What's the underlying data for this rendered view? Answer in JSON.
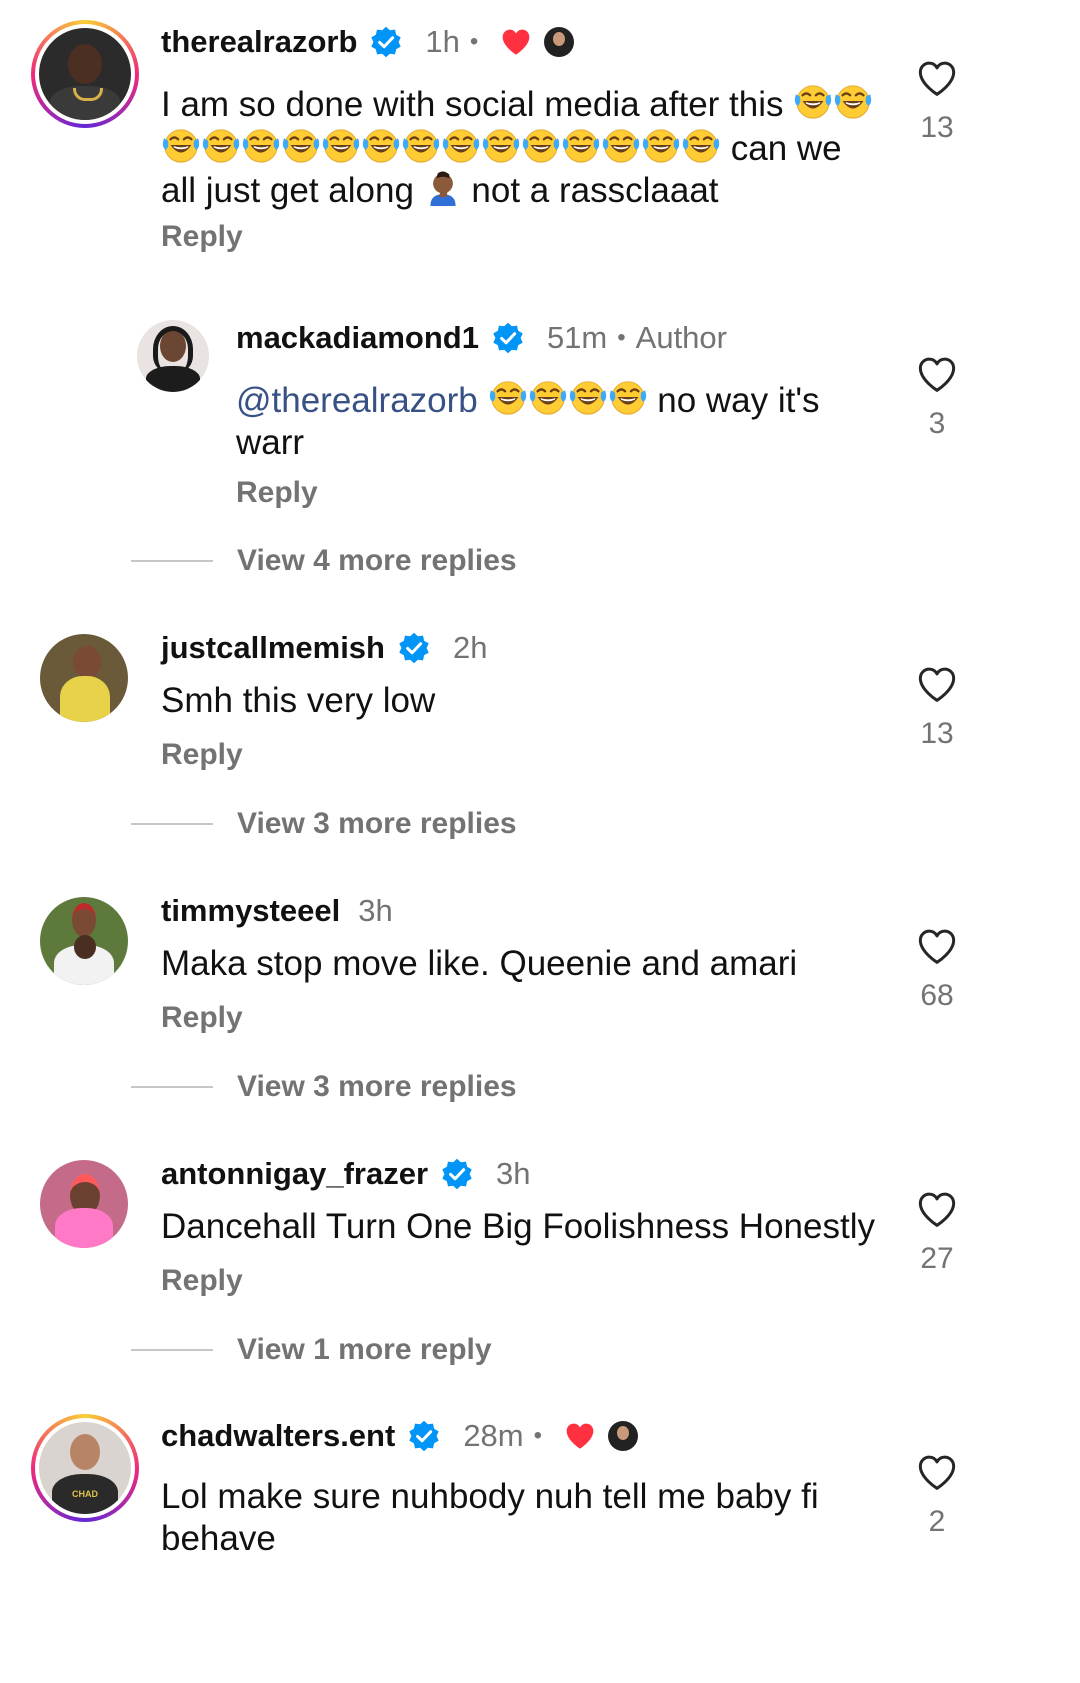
{
  "comments": [
    {
      "username": "therealrazorb",
      "verified": true,
      "time": "1h",
      "liked_by_author": true,
      "text_parts": [
        "I am so done with social media after this",
        "can we all just get along",
        "not a rassclaaat"
      ],
      "reply_label": "Reply",
      "likes": "13",
      "replies": [
        {
          "username": "mackadiamond1",
          "verified": true,
          "time": "51m",
          "badge": "Author",
          "mention": "@therealrazorb",
          "text": "no way it's warr",
          "reply_label": "Reply",
          "likes": "3"
        }
      ],
      "view_more": "View 4 more replies"
    },
    {
      "username": "justcallmemish",
      "verified": true,
      "time": "2h",
      "text": "Smh this very low",
      "reply_label": "Reply",
      "likes": "13",
      "view_more": "View 3 more replies"
    },
    {
      "username": "timmysteeel",
      "verified": false,
      "time": "3h",
      "text": "Maka stop move like. Queenie and amari",
      "reply_label": "Reply",
      "likes": "68",
      "view_more": "View 3 more replies"
    },
    {
      "username": "antonnigay_frazer",
      "verified": true,
      "time": "3h",
      "text": "Dancehall Turn One Big Foolishness Honestly",
      "reply_label": "Reply",
      "likes": "27",
      "view_more": "View 1 more reply"
    },
    {
      "username": "chadwalters.ent",
      "verified": true,
      "time": "28m",
      "liked_by_author": true,
      "text": "Lol make sure nuhbody nuh tell me baby fi behave",
      "likes": "2",
      "avatar_shirt_text": "CHAD"
    }
  ],
  "colors": {
    "verified": "#0095f6",
    "heart_red": "#ff3040",
    "muted": "#737373",
    "mention": "#385185"
  },
  "icons": {
    "like": "heart-outline-icon",
    "verified": "verified-badge-icon",
    "author_like": "red-heart-icon",
    "emoji_laugh": "face-with-tears-of-joy",
    "emoji_facepalm": "person-facepalming"
  }
}
